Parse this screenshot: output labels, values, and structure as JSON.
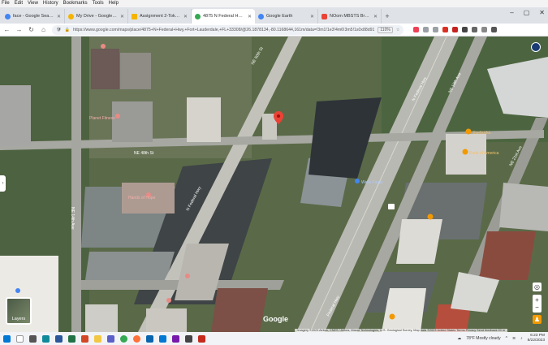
{
  "menu": [
    "File",
    "Edit",
    "View",
    "History",
    "Bookmarks",
    "Tools",
    "Help"
  ],
  "tabs": [
    {
      "label": "face - Google Search",
      "color": "#4285f4"
    },
    {
      "label": "My Drive - Google Drive",
      "color": "#f4b400"
    },
    {
      "label": "Assignment 2-Toks - Google Sli",
      "color": "#f4b400"
    },
    {
      "label": "4875 N Federal Hwy - Google M",
      "color": "#34a853",
      "active": true
    },
    {
      "label": "Google Earth",
      "color": "#4285f4"
    },
    {
      "label": "NOom MBSTS Bryce Hall Fox Th",
      "color": "#ea4335"
    }
  ],
  "browser": {
    "url": "https://www.google.com/maps/place/4875+N+Federal+Hwy,+Fort+Lauderdale,+FL+33308/@26.1878134,-80.1168644,161m/data=!3m1!1e3!4m6!3m5!1s0x88d91",
    "zoom": "110%"
  },
  "map": {
    "road_labels": [
      "NE 50th St",
      "NE 48th St",
      "NE 14th Ave",
      "N Federal Hwy",
      "N Federal Hwy",
      "NE 18th Ave",
      "NE 21st Ave",
      "Federal Hwy"
    ],
    "place_labels": [
      "Starbucks",
      "Bank of America",
      "Wells Fargo",
      "Planet Fitness",
      "Hands of Hope"
    ],
    "layers_label": "Layers",
    "logo": "Google",
    "attribution": "Imagery ©2023 Airbus, CNES / Airbus, Maxar Technologies, U.S. Geological Survey, Map data ©2023   United States   Terms   Privacy   Send feedback   20 m"
  },
  "taskbar": {
    "weather": "78°F  Mostly cloudy",
    "time": "6:23 PM",
    "date": "8/22/2023"
  }
}
